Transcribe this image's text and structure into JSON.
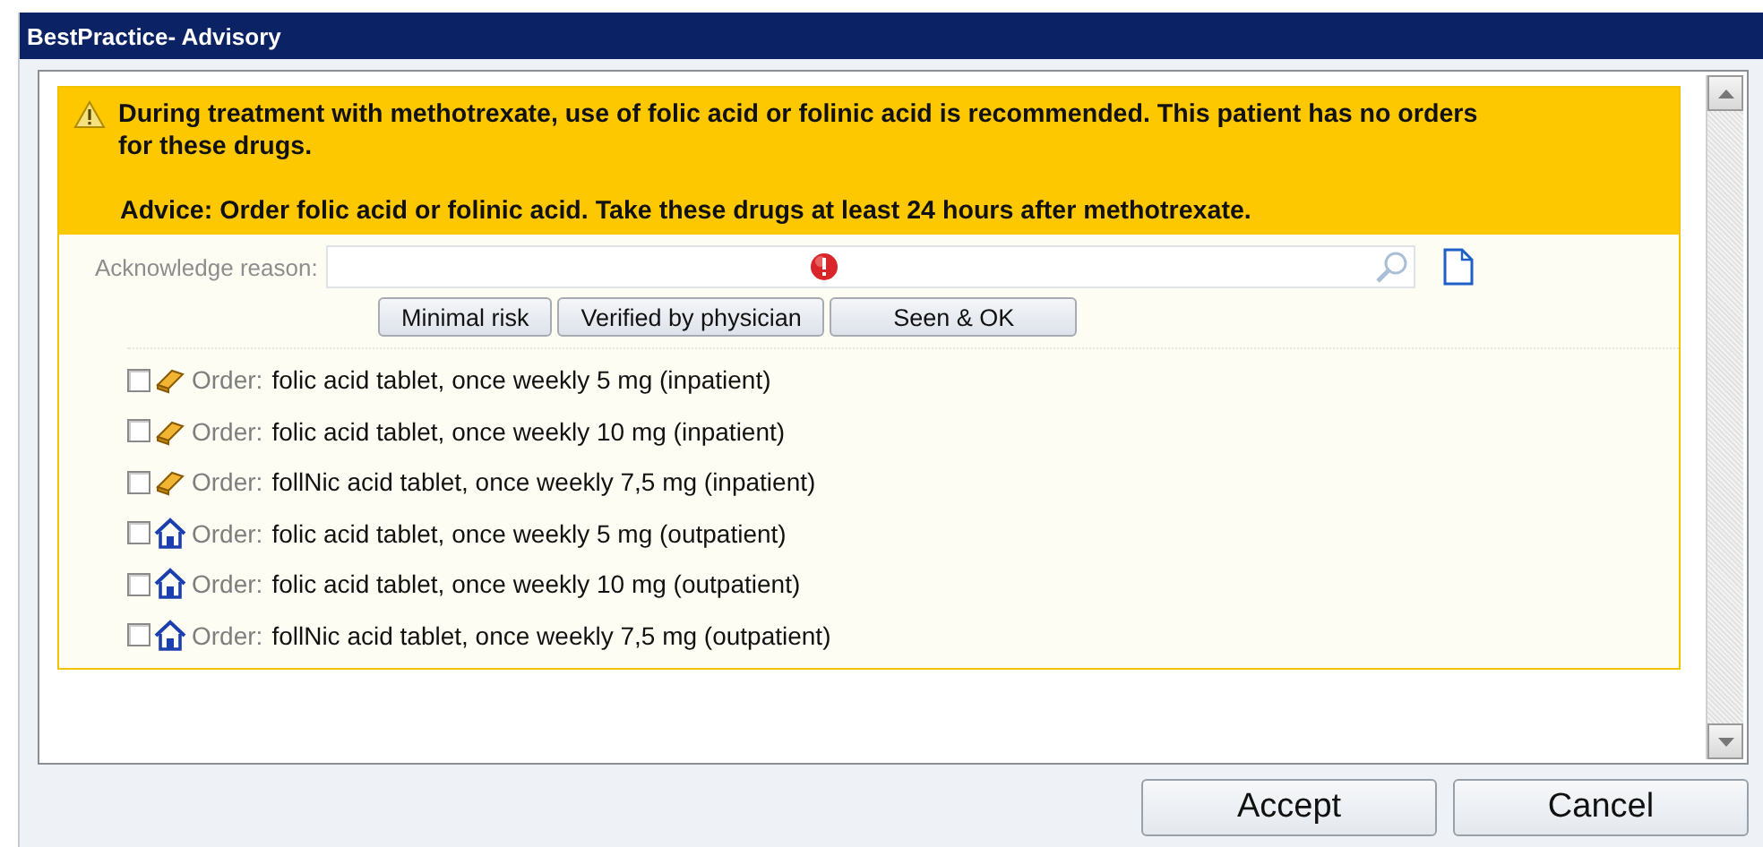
{
  "window": {
    "title": "BestPractice- Advisory"
  },
  "alert": {
    "message": "During treatment with methotrexate, use of folic acid or folinic acid is recommended. This patient has no orders for these drugs.",
    "advice": "Advice: Order folic acid or folinic acid. Take these drugs at least 24 hours after methotrexate."
  },
  "acknowledge": {
    "label": "Acknowledge reason:",
    "required": true,
    "buttons": [
      "Minimal risk",
      "Verified by physician",
      "Seen & OK"
    ]
  },
  "orders": [
    {
      "kind": "inpatient",
      "checked": false,
      "label": "Order:",
      "text": "folic acid tablet, once weekly 5 mg (inpatient)"
    },
    {
      "kind": "inpatient",
      "checked": false,
      "label": "Order:",
      "text": "folic acid tablet, once weekly 10 mg (inpatient)"
    },
    {
      "kind": "inpatient",
      "checked": false,
      "label": "Order:",
      "text": "follNic acid tablet, once weekly 7,5 mg (inpatient)"
    },
    {
      "kind": "outpatient",
      "checked": false,
      "label": "Order:",
      "text": "folic acid tablet, once weekly 5 mg (outpatient)"
    },
    {
      "kind": "outpatient",
      "checked": false,
      "label": "Order:",
      "text": "folic acid tablet, once weekly 10 mg (outpatient)"
    },
    {
      "kind": "outpatient",
      "checked": false,
      "label": "Order:",
      "text": "follNic acid tablet, once weekly 7,5 mg (outpatient)"
    }
  ],
  "buttons": [
    "Accept",
    "Cancel"
  ]
}
